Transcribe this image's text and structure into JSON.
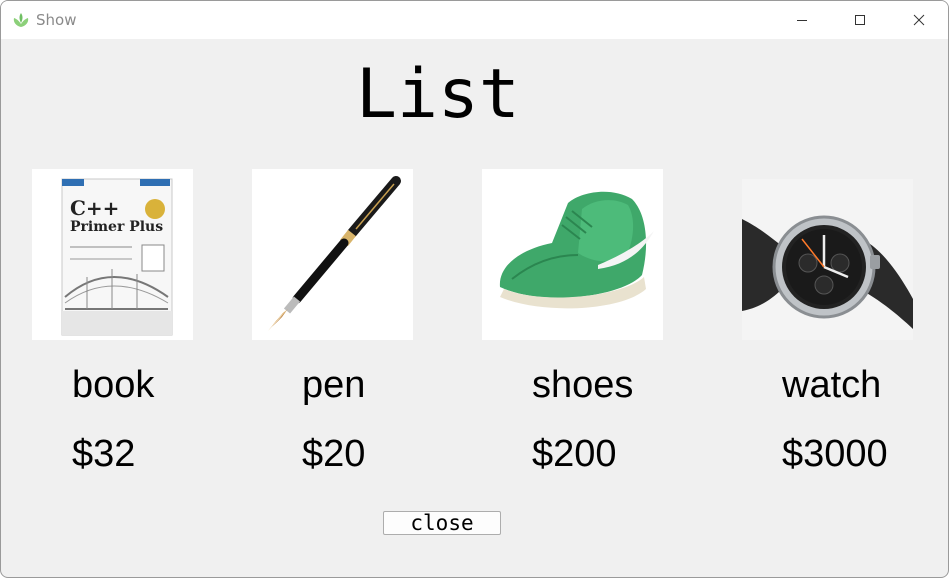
{
  "window": {
    "title": "Show",
    "icon": "leaf-app-icon",
    "controls": [
      "minimize",
      "maximize",
      "close"
    ]
  },
  "heading": "List",
  "products": [
    {
      "name": "book",
      "price": "$32",
      "image": "c-plus-plus-primer-plus-book-cover"
    },
    {
      "name": "pen",
      "price": "$20",
      "image": "black-gold-fountain-pen"
    },
    {
      "name": "shoes",
      "price": "$200",
      "image": "green-high-top-sneaker"
    },
    {
      "name": "watch",
      "price": "$3000",
      "image": "chronograph-wristwatch"
    }
  ],
  "book_cover": {
    "title_line1": "C++",
    "title_line2": "Primer Plus"
  },
  "close_button": "close",
  "colors": {
    "window_bg": "#f0f0f0",
    "titlebar_bg": "#ffffff",
    "title_text": "#8a8a8a",
    "shoe_green": "#3fa86a",
    "app_icon_green": "#7cc47a"
  }
}
